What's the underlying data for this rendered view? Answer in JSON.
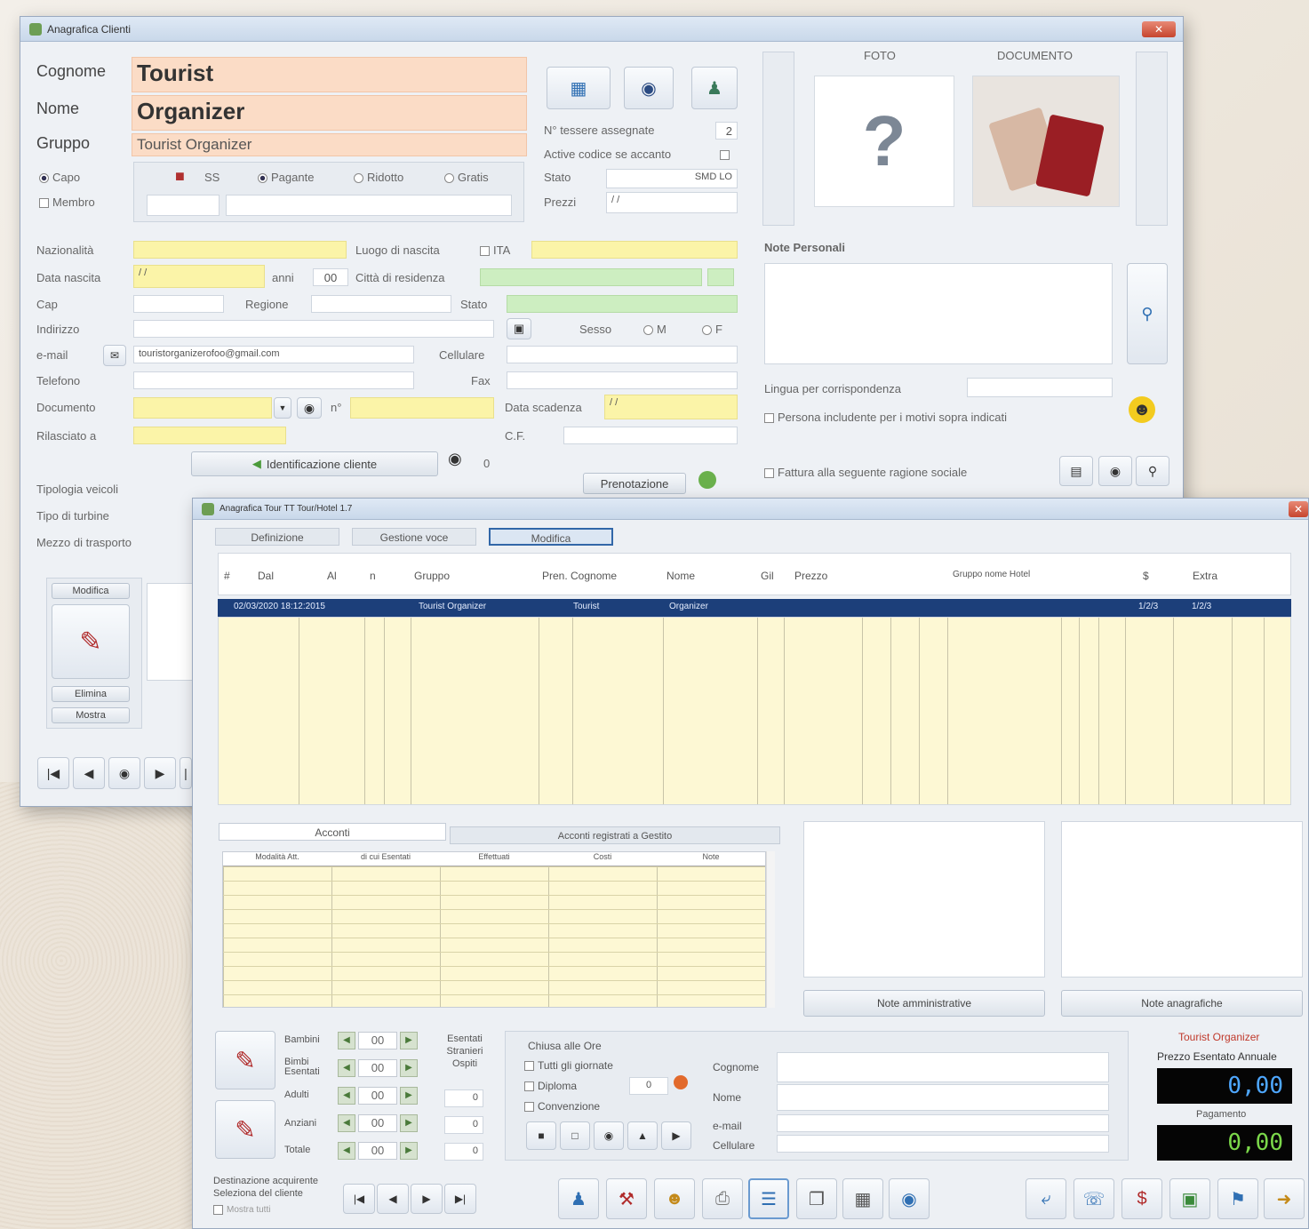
{
  "back_window": {
    "title": "Anagrafica Clienti",
    "fields": {
      "cognome_label": "Cognome",
      "cognome_value": "Tourist",
      "nome_label": "Nome",
      "nome_value": "Organizer",
      "gruppo_label": "Gruppo",
      "gruppo_value": "Tourist Organizer"
    },
    "radio_capo": "Capo",
    "radio_membro": "Membro",
    "options": {
      "ss": "SS",
      "pagante": "Pagante",
      "ridotto": "Ridotto",
      "gratis": "Gratis"
    },
    "right_info": {
      "n_tessere_label": "N° tessere assegnate",
      "n_tessere_value": "2",
      "active_label": "Active codice se accanto",
      "stato_label": "Stato",
      "stato_value": "SMD LO",
      "prezzi_label": "Prezzi",
      "prezzi_value": "/ /"
    },
    "foto_label": "FOTO",
    "documento_label": "DOCUMENTO",
    "nazionalita_label": "Nazionalità",
    "luogo_nascita_label": "Luogo di nascita",
    "ita_label": "ITA",
    "data_nascita_label": "Data nascita",
    "data_nascita_value": "/ /",
    "anni_label": "anni",
    "anni_value": "00",
    "citta_label": "Città di residenza",
    "cap_label": "Cap",
    "regione_label": "Regione",
    "stato_label": "Stato",
    "indirizzo_label": "Indirizzo",
    "sesso_label": "Sesso",
    "sesso_m": "M",
    "sesso_f": "F",
    "email_label": "e-mail",
    "email_value": "touristorganizerofoo@gmail.com",
    "cellulare_label": "Cellulare",
    "telefono_label": "Telefono",
    "fax_label": "Fax",
    "documento_field_label": "Documento",
    "n_label": "n°",
    "data_scadenza_label": "Data scadenza",
    "data_scadenza_value": "/ /",
    "rilasciato_label": "Rilasciato a",
    "cf_label": "C.F.",
    "identificazione_button": "Identificazione cliente",
    "note_personali_label": "Note Personali",
    "lingua_label": "Lingua per corrispondenza",
    "persona_label": "Persona includente per i motivi sopra indicati",
    "fattura_label": "Fattura alla seguente ragione sociale",
    "prenotazione_button": "Prenotazione",
    "lower_labels": [
      "Tipologia veicoli",
      "Tipo di turbine",
      "Mezzo di trasporto"
    ],
    "small_buttons": [
      "Modifica",
      "Elimina",
      "Mostra"
    ],
    "nav_buttons": [
      "first",
      "prev",
      "find",
      "next",
      "last"
    ]
  },
  "front_window": {
    "title": "Anagrafica Tour TT Tour/Hotel 1.7",
    "tabs": [
      "Definizione",
      "Gestione voce",
      "Modifica"
    ],
    "grid_headers": [
      "#",
      "Dal",
      "Al",
      "n",
      "Gruppo",
      "Pren. Cognome",
      "Nome",
      "Gil",
      "Prezzo",
      "Gruppo nome Hotel",
      "$",
      "Extra"
    ],
    "selected_row": [
      "02/03/2020 18:12:2015",
      "Tourist Organizer",
      "Tourist",
      "Organizer",
      "1/2/3",
      "1/2/3"
    ],
    "sub_tabs": [
      "Acconti",
      "Acconti registrati a Gestito"
    ],
    "sub_headers": [
      "Modalità Att.",
      "di cui Esentati",
      "Effettuati",
      "Costi",
      "Note"
    ],
    "note_btn_1": "Note amministrative",
    "note_btn_2": "Note anagrafiche",
    "counters": [
      {
        "label": "Bambini",
        "value": "00"
      },
      {
        "label": "Bimbi Esentati",
        "value": "00"
      },
      {
        "label": "Adulti",
        "value": "00"
      },
      {
        "label": "Anziani",
        "value": "00"
      },
      {
        "label": "Totale",
        "value": "00"
      }
    ],
    "counter_side_label": "Esentati Stranieri Ospiti",
    "small_values": [
      "0",
      "0",
      "0"
    ],
    "options_label": "Chiusa alle Ore",
    "opt_checks": [
      "Tutti gli giornate",
      "Diploma",
      "Convenzione"
    ],
    "opt_field": "0",
    "contact_labels": [
      "Cognome",
      "Nome",
      "e-mail",
      "Cellulare"
    ],
    "totals_title": "Tourist Organizer",
    "totals_sub": "Prezzo Esentato Annuale",
    "lcd1": "0,00",
    "lcd_label2": "Pagamento",
    "lcd2": "0,00",
    "footer_label": "Destinazione acquirente\nSeleziona del cliente",
    "footer_check": "Mostra tutti"
  }
}
